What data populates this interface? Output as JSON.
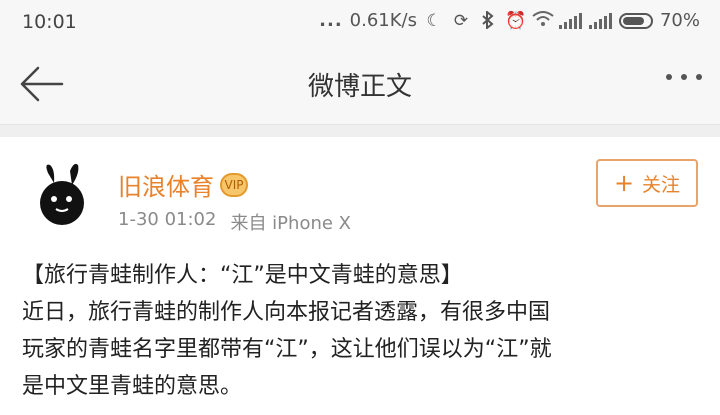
{
  "status_bar": {
    "time": "10:01",
    "dots": "...",
    "speed": "0.61K/s",
    "battery": "70%",
    "icons": [
      "moon-icon",
      "sync-icon",
      "bluetooth-icon",
      "alarm-icon",
      "wifi-icon",
      "signal-icon",
      "signal-icon",
      "battery-icon"
    ]
  },
  "nav": {
    "title": "微博正文"
  },
  "post": {
    "author": "旧浪体育",
    "author_badge": "VIP",
    "time": "1-30 01:02",
    "source": "来自 iPhone X",
    "follow_plus": "+",
    "follow_label": "关注",
    "lines": [
      "【旅行青蛙制作人：“江”是中文青蛙的意思】",
      "近日，旅行青蛙的制作人向本报记者透露，有很多中国",
      "玩家的青蛙名字里都带有“江”，这让他们误以为“江”就",
      "是中文里青蛙的意思。"
    ]
  },
  "colors": {
    "accent": "#e8822b",
    "meta_gray": "#8a8a8a"
  }
}
